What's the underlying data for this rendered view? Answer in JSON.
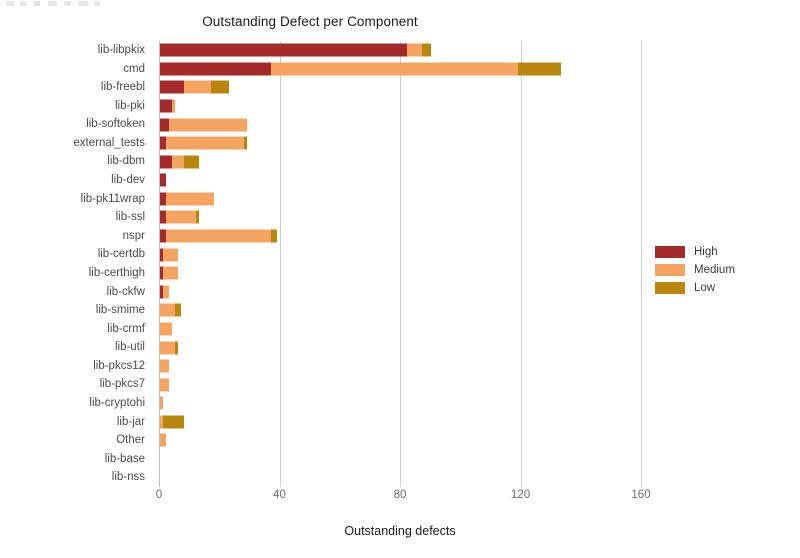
{
  "chart_data": {
    "type": "bar",
    "orientation": "horizontal",
    "stacked": true,
    "title": "Outstanding Defect per Component",
    "xlabel": "Outstanding defects",
    "ylabel": "",
    "xlim": [
      0,
      160
    ],
    "xticks": [
      0,
      40,
      80,
      120,
      160
    ],
    "xtick_labels": [
      "0",
      "40",
      "80",
      "120",
      "160"
    ],
    "grid": "vertical",
    "legend_position": "right",
    "categories": [
      "lib-libpkix",
      "cmd",
      "lib-freebl",
      "lib-pki",
      "lib-softoken",
      "external_tests",
      "lib-dbm",
      "lib-dev",
      "lib-pk11wrap",
      "lib-ssl",
      "nspr",
      "lib-certdb",
      "lib-certhigh",
      "lib-ckfw",
      "lib-smime",
      "lib-crmf",
      "lib-util",
      "lib-pkcs12",
      "lib-pkcs7",
      "lib-cryptohi",
      "lib-jar",
      "Other",
      "lib-base",
      "lib-nss"
    ],
    "series": [
      {
        "name": "High",
        "color": "#A52A2A",
        "values": [
          82,
          37,
          8,
          4,
          3,
          2,
          4,
          2,
          2,
          2,
          2,
          1,
          1,
          1,
          0,
          0,
          0,
          0,
          0,
          0,
          0,
          0,
          0,
          0
        ]
      },
      {
        "name": "Medium",
        "color": "#F4A460",
        "values": [
          5,
          82,
          9,
          1,
          26,
          26,
          4,
          0,
          16,
          10,
          35,
          5,
          5,
          2,
          5,
          4,
          5,
          3,
          3,
          1,
          1,
          2,
          0,
          0
        ]
      },
      {
        "name": "Low",
        "color": "#B8860B",
        "values": [
          3,
          14,
          6,
          0,
          0,
          1,
          5,
          0,
          0,
          1,
          2,
          0,
          0,
          0,
          2,
          0,
          1,
          0,
          0,
          0,
          7,
          0,
          0,
          0
        ]
      }
    ],
    "totals": [
      90,
      133,
      23,
      5,
      29,
      29,
      13,
      2,
      18,
      13,
      39,
      6,
      6,
      3,
      7,
      4,
      6,
      3,
      3,
      1,
      8,
      2,
      0,
      0
    ]
  },
  "legend": {
    "items": [
      {
        "label": "High",
        "color": "#A52A2A"
      },
      {
        "label": "Medium",
        "color": "#F4A460"
      },
      {
        "label": "Low",
        "color": "#B8860B"
      }
    ]
  },
  "colors": {
    "high": "#A52A2A",
    "medium": "#F4A460",
    "low": "#B8860B",
    "grid": "#cccccc",
    "axis": "#bdbdbd",
    "background": "#ffffff",
    "title_text": "#1a1a1a",
    "tick_text": "#6b6b6b",
    "category_text": "#4a4a4a"
  }
}
